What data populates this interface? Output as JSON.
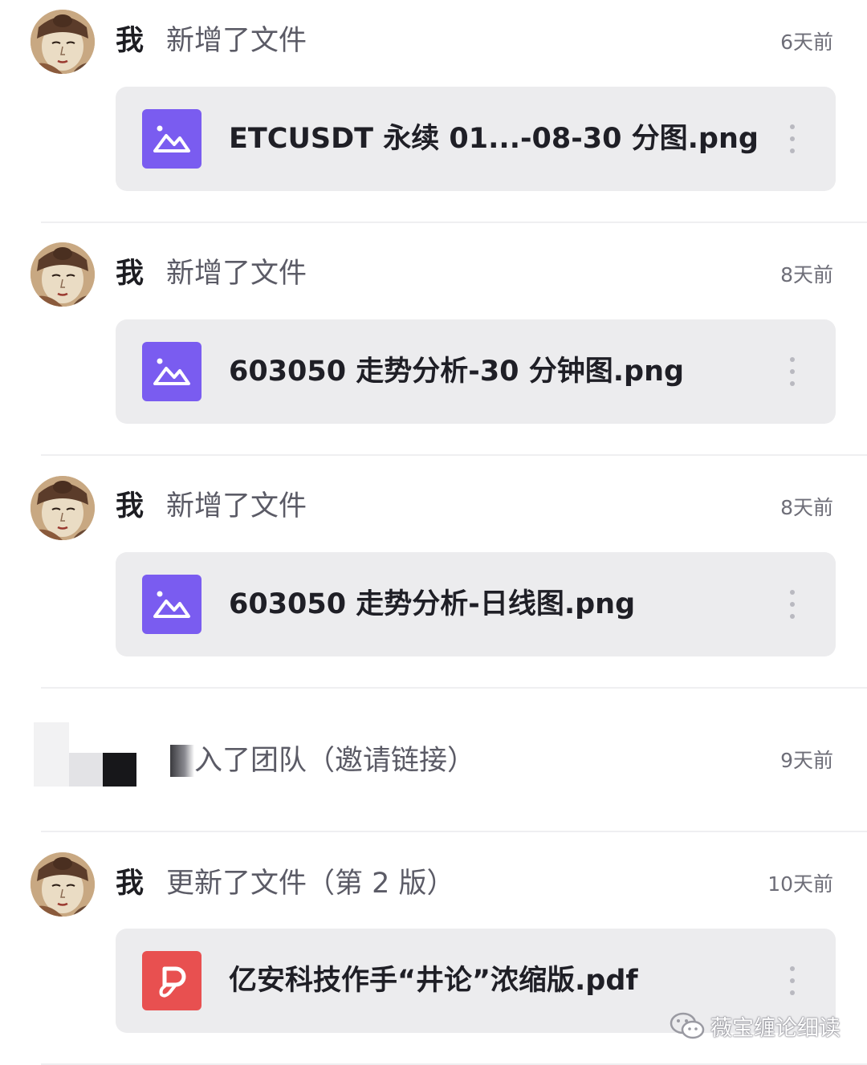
{
  "feed": [
    {
      "actor": "我",
      "action": "新增了文件",
      "time": "6天前",
      "file": {
        "name": "ETCUSDT 永续 01...-08-30 分图.png",
        "type": "image-file-icon",
        "icon_color": "#7a5cf0"
      }
    },
    {
      "actor": "我",
      "action": "新增了文件",
      "time": "8天前",
      "file": {
        "name": "603050 走势分析-30 分钟图.png",
        "type": "image-file-icon",
        "icon_color": "#7a5cf0"
      }
    },
    {
      "actor": "我",
      "action": "新增了文件",
      "time": "8天前",
      "file": {
        "name": "603050 走势分析-日线图.png",
        "type": "image-file-icon",
        "icon_color": "#7a5cf0"
      }
    },
    {
      "actor": "",
      "action": "加入了团队（邀请链接）",
      "action_visible": "入了团队（邀请链接）",
      "time": "9天前"
    },
    {
      "actor": "我",
      "action": "更新了文件（第 2 版）",
      "time": "10天前",
      "file": {
        "name": "亿安科技作手“井论”浓缩版.pdf",
        "type": "pdf-file-icon",
        "icon_color": "#e85050"
      }
    }
  ],
  "watermark": {
    "text": "薇宝缠论细读",
    "icon": "wechat-icon"
  },
  "colors": {
    "card_bg": "#ececee",
    "image_icon": "#7a5cf0",
    "pdf_icon": "#e85050",
    "muted_text": "#5b5b66"
  }
}
